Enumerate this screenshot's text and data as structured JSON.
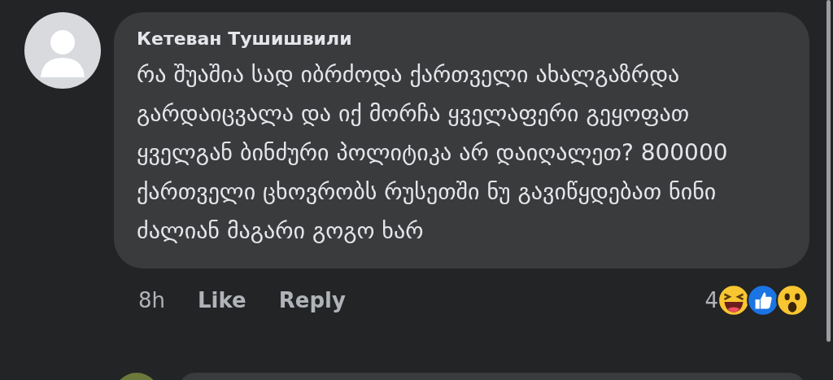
{
  "comment": {
    "author": "Кетеван Тушишвили",
    "text": "რა შუაშია სად იბრძოდა ქართველი ახალგაზრდა გარდაიცვალა და იქ მორჩა ყველაფერი გეყოფათ ყველგან ბინძური პოლიტიკა არ დაიღალეთ? 800000 ქართველი ცხოვრობს რუსეთში ნუ გავიწყდებათ ნინი ძალიან მაგარი გოგო ხარ",
    "time": "8h",
    "actions": [
      "Like",
      "Reply"
    ],
    "reaction_count": "4",
    "reactions": [
      {
        "kind": "haha"
      },
      {
        "kind": "like"
      },
      {
        "kind": "wow"
      }
    ]
  }
}
